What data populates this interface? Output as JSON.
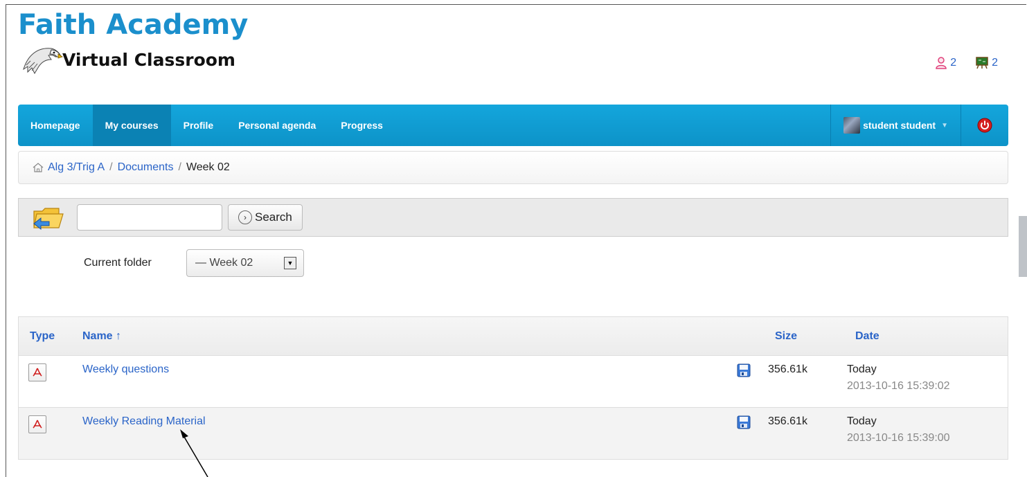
{
  "header": {
    "title": "Faith Academy",
    "subtitle": "Virtual Classroom",
    "users_count": "2",
    "classes_count": "2"
  },
  "nav": {
    "items": [
      {
        "label": "Homepage"
      },
      {
        "label": "My courses"
      },
      {
        "label": "Profile"
      },
      {
        "label": "Personal agenda"
      },
      {
        "label": "Progress"
      }
    ],
    "active": "My courses",
    "user_label": "student student"
  },
  "breadcrumb": {
    "items": [
      "Alg 3/Trig A",
      "Documents"
    ],
    "current": "Week 02"
  },
  "toolbar": {
    "search_value": "",
    "search_label": "Search"
  },
  "folder": {
    "label": "Current folder",
    "selected": "— Week 02"
  },
  "table": {
    "headers": {
      "type": "Type",
      "name": "Name ↑",
      "size": "Size",
      "date": "Date"
    },
    "rows": [
      {
        "name": "Weekly questions",
        "size": "356.61k",
        "date_relative": "Today",
        "date_absolute": "2013-10-16 15:39:02",
        "file_type": "pdf"
      },
      {
        "name": "Weekly Reading Material",
        "size": "356.61k",
        "date_relative": "Today",
        "date_absolute": "2013-10-16 15:39:00",
        "file_type": "pdf"
      }
    ]
  },
  "colors": {
    "brand_blue": "#1b8fcc",
    "nav_blue": "#14a6dc",
    "link_blue": "#2a64c8"
  }
}
